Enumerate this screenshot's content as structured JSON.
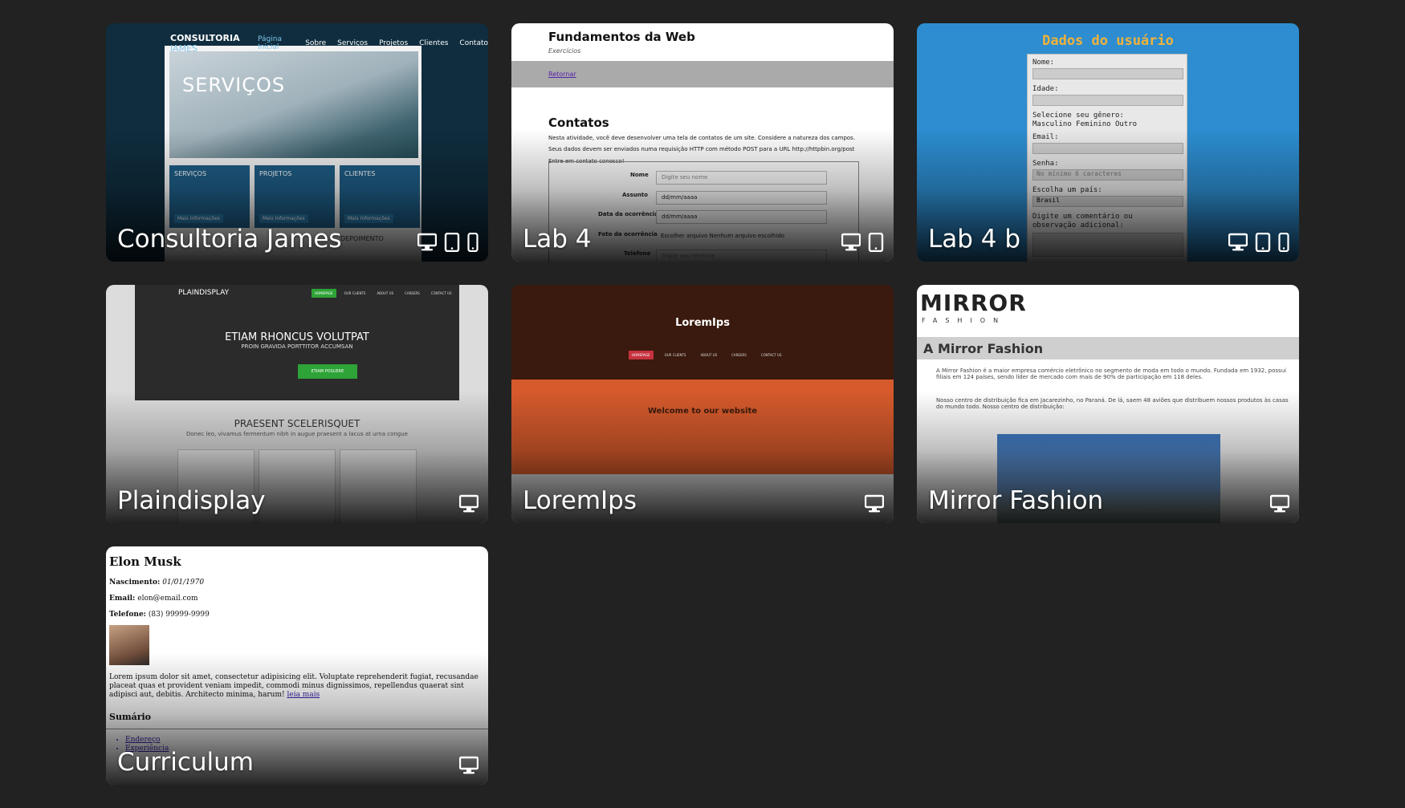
{
  "colors": {
    "page_bg": "#222222",
    "card_title": "#ffffff",
    "icon": "#ffffff"
  },
  "cards": [
    {
      "title": "Consultoria James",
      "devices": [
        "desktop-icon",
        "tablet-icon",
        "phone-icon"
      ],
      "preview": {
        "logo_a": "CONSULTORIA",
        "logo_b": "JAMES",
        "nav": [
          "Página Inicial",
          "Sobre",
          "Serviços",
          "Projetos",
          "Clientes",
          "Contato"
        ],
        "hero": "SERVIÇOS",
        "boxes": [
          "SERVIÇOS",
          "PROJETOS",
          "CLIENTES"
        ],
        "box_button": "Mais Informações",
        "side": "DEPOIMENTO"
      }
    },
    {
      "title": "Lab 4",
      "devices": [
        "desktop-icon",
        "tablet-icon"
      ],
      "preview": {
        "heading": "Fundamentos da Web",
        "subheading": "Exercícios",
        "link": "Retornar",
        "section": "Contatos",
        "lines": [
          "Nesta atividade, você deve desenvolver uma tela de contatos de um site. Considere a natureza dos campos.",
          "Seus dados devem ser enviados numa requisição HTTP com método POST para a URL http://httpbin.org/post",
          "Entre em contato conosco!"
        ],
        "fields": [
          {
            "label": "Nome",
            "value": "Digite seu nome"
          },
          {
            "label": "Assunto",
            "value": "dd/mm/aaaa"
          },
          {
            "label": "Data da ocorrência",
            "value": "dd/mm/aaaa"
          },
          {
            "label": "Foto da ocorrência",
            "value": "Escolher arquivo  Nenhum arquivo escolhido"
          },
          {
            "label": "Telefone",
            "value": "Digite seu telefone"
          }
        ]
      }
    },
    {
      "title": "Lab 4 b",
      "devices": [
        "desktop-icon",
        "tablet-icon",
        "phone-icon"
      ],
      "preview": {
        "heading": "Dados do usuário",
        "labels": [
          "Nome:",
          "Idade:",
          "Selecione seu gênero:",
          "Email:",
          "Senha:",
          "Escolha um país:",
          "Digite um comentário ou"
        ],
        "genders": "Masculino  Feminino  Outro",
        "senha_placeholder": "No mínimo 6 caracteres",
        "pais": "Brasil",
        "comment_line2": "observação adicional:"
      }
    },
    {
      "title": "Plaindisplay",
      "devices": [
        "desktop-icon"
      ],
      "preview": {
        "brand": "PLAINDISPLAY",
        "nav": [
          "HOMEPAGE",
          "OUR CLIENTS",
          "ABOUT US",
          "CAREERS",
          "CONTACT US"
        ],
        "hero": "ETIAM RHONCUS VOLUTPAT",
        "hero_sub": "PROIN GRAVIDA PORTTITOR ACCUMSAN",
        "button": "ETIAM POSUERE",
        "section": "PRAESENT SCELERISQUET",
        "section_sub": "Donec leo, vivamus fermentum nibh in augue praesent a lacus at urna congue"
      }
    },
    {
      "title": "LoremIps",
      "devices": [
        "desktop-icon"
      ],
      "preview": {
        "logo": "LoremIps",
        "nav": [
          "HOMEPAGE",
          "OUR CLIENTS",
          "ABOUT US",
          "CAREERS",
          "CONTACT US"
        ],
        "welcome": "Welcome to our website"
      }
    },
    {
      "title": "Mirror Fashion",
      "devices": [
        "desktop-icon"
      ],
      "preview": {
        "logo": "MIRROR",
        "sub": "FASHION",
        "bar": "A Mirror Fashion",
        "p1": "A Mirror Fashion é a maior empresa comércio eletrônico no segmento de moda em todo o mundo. Fundada em 1932, possui filiais em 124 países, sendo líder de mercado com mais de 90% de participação em 118 deles.",
        "p2": "Nosso centro de distribuição fica em Jacarezinho, no Paraná. De lá, saem 48 aviões que distribuem nossos produtos às casas do mundo todo. Nosso centro de distribuição:"
      }
    },
    {
      "title": "Curriculum",
      "devices": [
        "desktop-icon"
      ],
      "preview": {
        "name": "Elon Musk",
        "nasc_label": "Nascimento:",
        "nasc": "01/01/1970",
        "email_label": "Email:",
        "email": "elon@email.com",
        "tel_label": "Telefone:",
        "tel": "(83) 99999-9999",
        "para": "Lorem ipsum dolor sit amet, consectetur adipisicing elit. Voluptate reprehenderit fugiat, recusandae placeat quas et provident veniam impedit, commodi minus dignissimos, repellendus quaerat sint adipisci aut, debitis. Architecto minima, harum!",
        "more": "leia mais",
        "summary": "Sumário",
        "toc": [
          "Endereço",
          "Experiência"
        ]
      }
    }
  ]
}
